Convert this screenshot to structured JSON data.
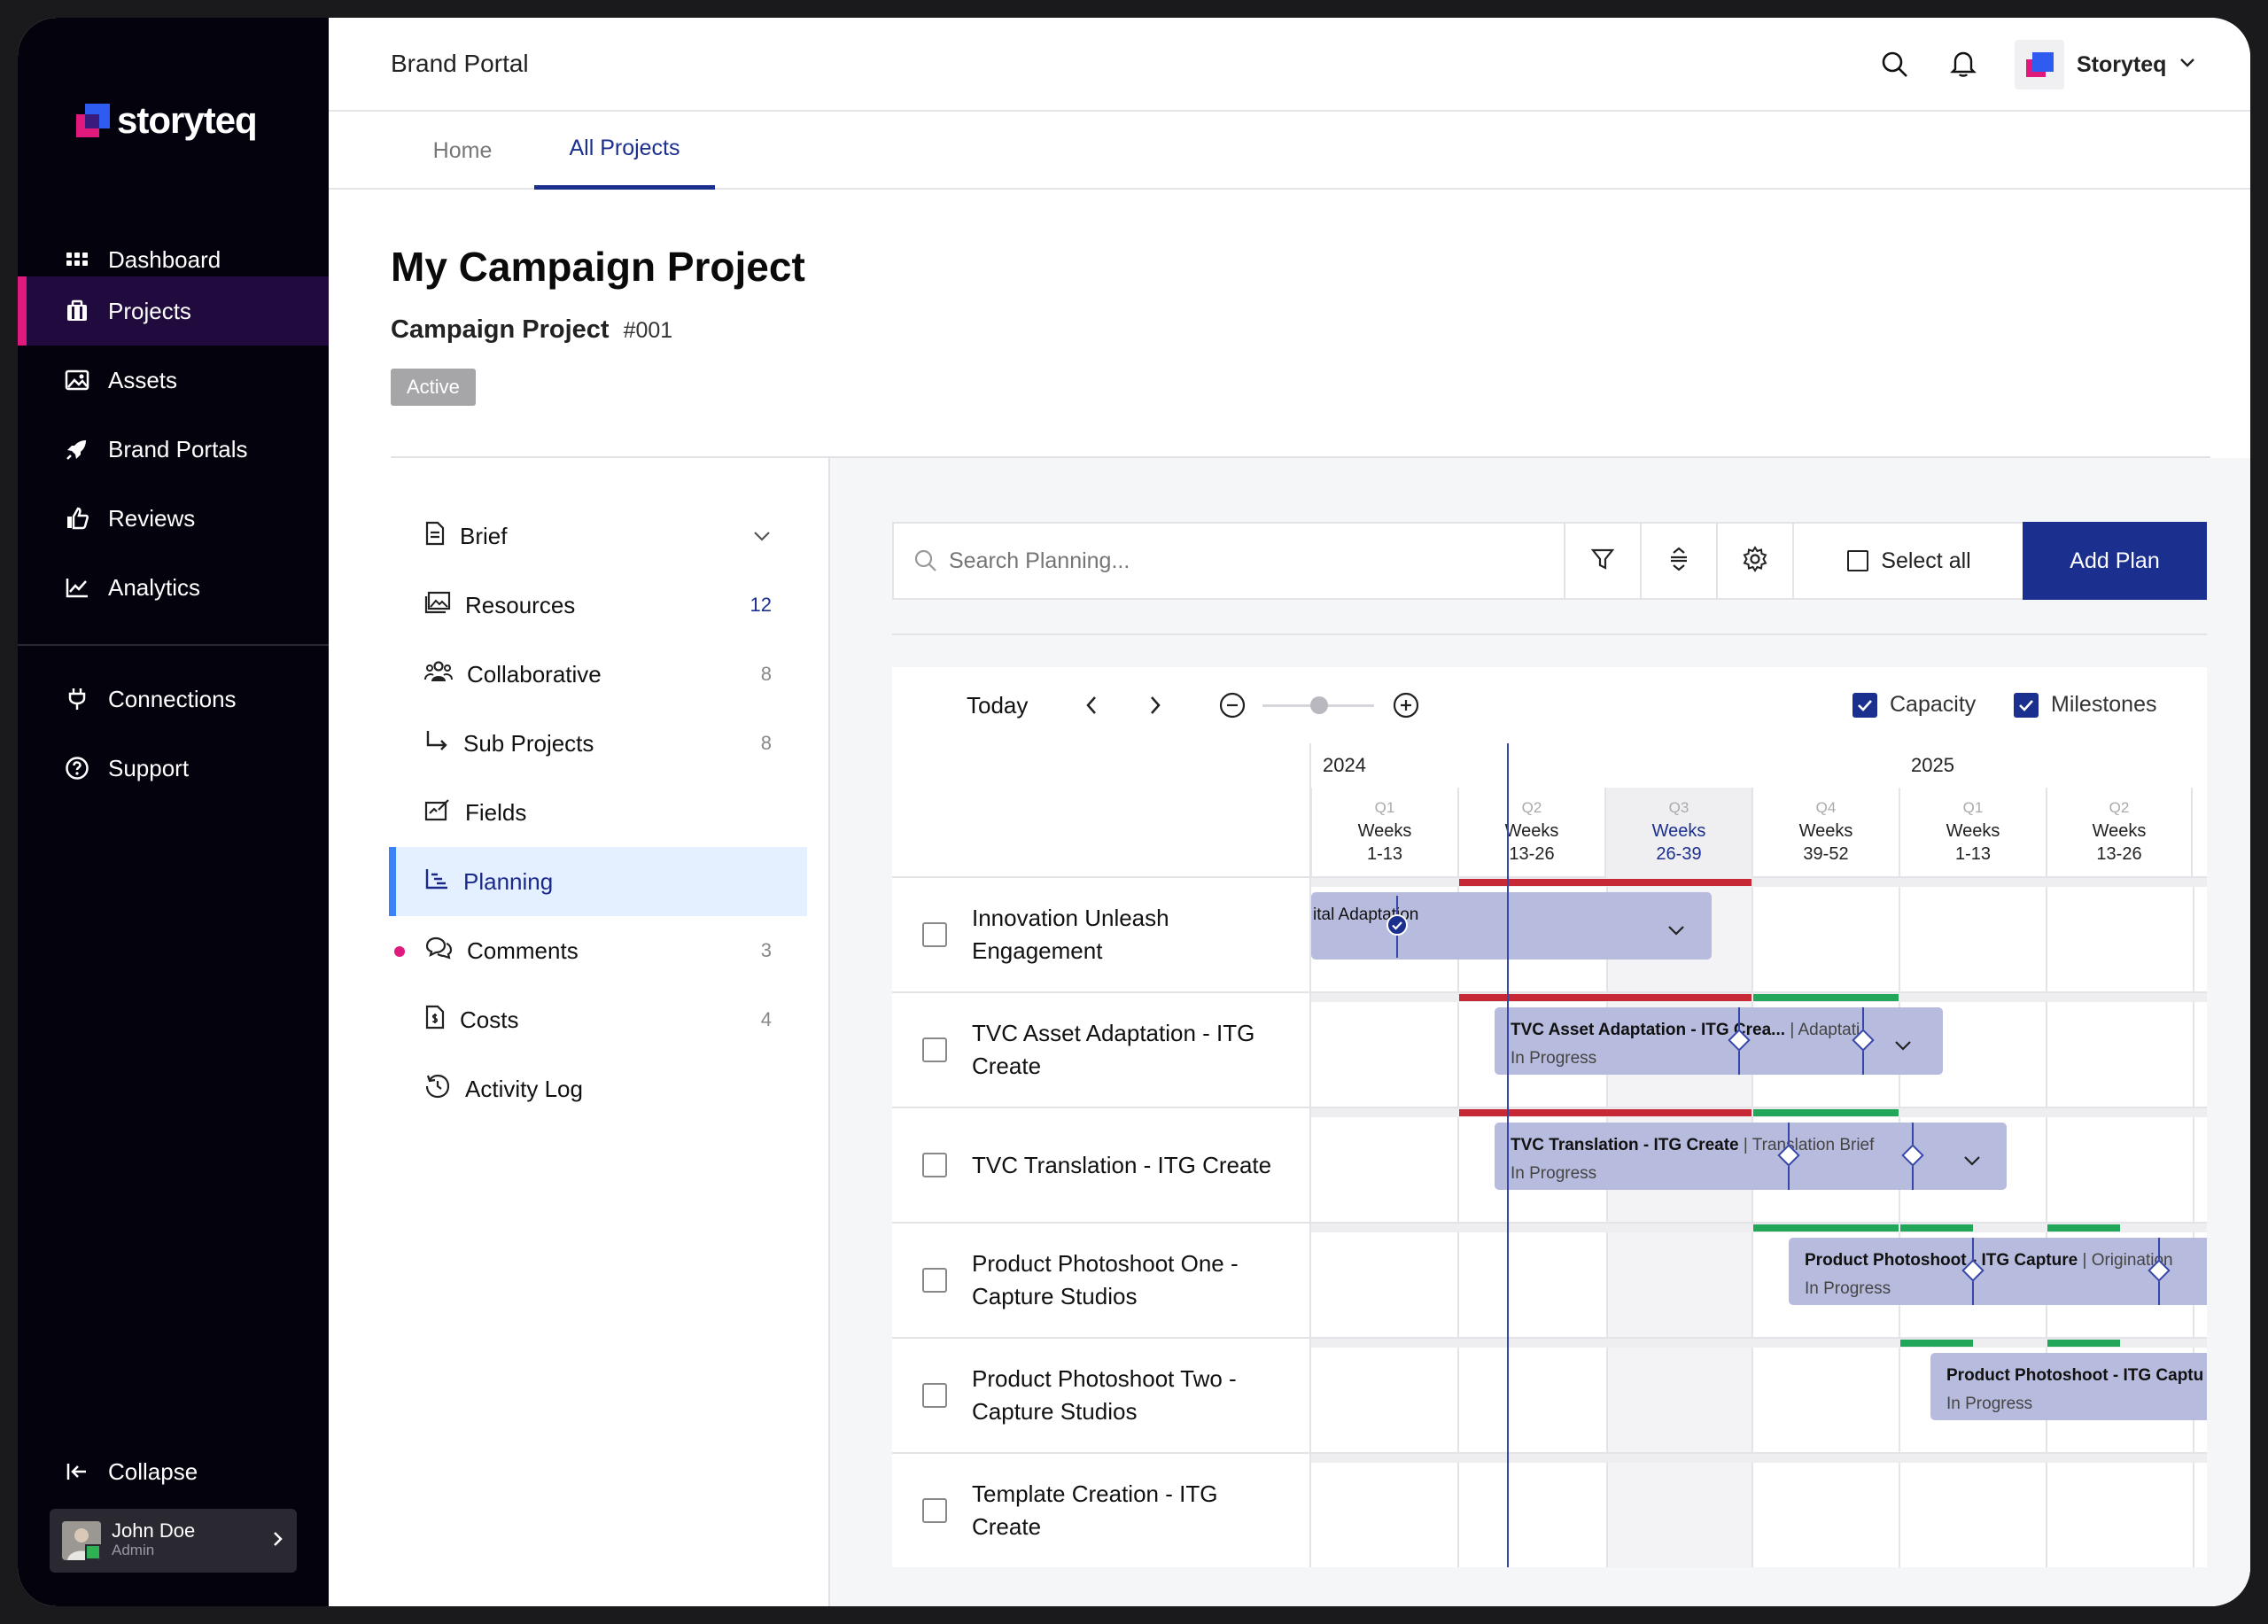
{
  "brand": {
    "name": "storyteq"
  },
  "sidebar": {
    "items": [
      {
        "label": "Dashboard",
        "icon": "dashboard-icon"
      },
      {
        "label": "Projects",
        "icon": "projects-icon"
      },
      {
        "label": "Assets",
        "icon": "image-icon"
      },
      {
        "label": "Brand Portals",
        "icon": "rocket-icon"
      },
      {
        "label": "Reviews",
        "icon": "thumbs-up-icon"
      },
      {
        "label": "Analytics",
        "icon": "chart-line-icon"
      }
    ],
    "bottom_items": [
      {
        "label": "Connections",
        "icon": "plug-icon"
      },
      {
        "label": "Support",
        "icon": "help-icon"
      }
    ],
    "collapse_label": "Collapse",
    "user": {
      "name": "John Doe",
      "role": "Admin"
    }
  },
  "header": {
    "title": "Brand Portal",
    "account": "Storyteq"
  },
  "tabs": [
    {
      "label": "Home"
    },
    {
      "label": "All Projects"
    }
  ],
  "project": {
    "title": "My Campaign Project",
    "type": "Campaign Project",
    "id": "#001",
    "status": "Active"
  },
  "project_menu": [
    {
      "label": "Brief",
      "count": ""
    },
    {
      "label": "Resources",
      "count": "12"
    },
    {
      "label": "Collaborative",
      "count": "8"
    },
    {
      "label": "Sub Projects",
      "count": "8"
    },
    {
      "label": "Fields",
      "count": ""
    },
    {
      "label": "Planning",
      "count": ""
    },
    {
      "label": "Comments",
      "count": "3"
    },
    {
      "label": "Costs",
      "count": "4"
    },
    {
      "label": "Activity Log",
      "count": ""
    }
  ],
  "planning": {
    "search_placeholder": "Search Planning...",
    "select_all": "Select all",
    "add_plan": "Add Plan",
    "today": "Today",
    "capacity": "Capacity",
    "milestones": "Milestones",
    "years": [
      "2024",
      "2025"
    ],
    "quarters": [
      {
        "q": "Q1",
        "weeks": "Weeks",
        "range": "1-13"
      },
      {
        "q": "Q2",
        "weeks": "Weeks",
        "range": "13-26"
      },
      {
        "q": "Q3",
        "weeks": "Weeks",
        "range": "26-39"
      },
      {
        "q": "Q4",
        "weeks": "Weeks",
        "range": "39-52"
      },
      {
        "q": "Q1",
        "weeks": "Weeks",
        "range": "1-13"
      },
      {
        "q": "Q2",
        "weeks": "Weeks",
        "range": "13-26"
      }
    ],
    "rows": [
      {
        "label": "Innovation Unleash Engagement",
        "bar_title": "ital Adaptation",
        "bar_sub": ""
      },
      {
        "label": "TVC Asset Adaptation - ITG Create",
        "bar_title": "TVC Asset Adaptation - ITG Crea...",
        "bar_extra": "|  Adaptati",
        "bar_sub": "In Progress"
      },
      {
        "label": "TVC Translation - ITG Create",
        "bar_title": "TVC Translation - ITG Create",
        "bar_extra": "|  Translation Brief",
        "bar_sub": "In Progress"
      },
      {
        "label": "Product Photoshoot One - Capture Studios",
        "bar_title": "Product Photoshoot - ITG Capture",
        "bar_extra": "|  Origination",
        "bar_sub": "In Progress"
      },
      {
        "label": "Product Photoshoot Two - Capture Studios",
        "bar_title": "Product Photoshoot - ITG Captu",
        "bar_sub": "In Progress"
      },
      {
        "label": "Template Creation - ITG Create",
        "bar_title": "",
        "bar_sub": ""
      }
    ]
  },
  "colors": {
    "accent": "#1b2f8f",
    "sidebar_bg": "#04020d",
    "active_pink": "#e0197d",
    "capacity_red": "#c62835",
    "capacity_green": "#22a65a",
    "bar": "#b7bcdf"
  }
}
